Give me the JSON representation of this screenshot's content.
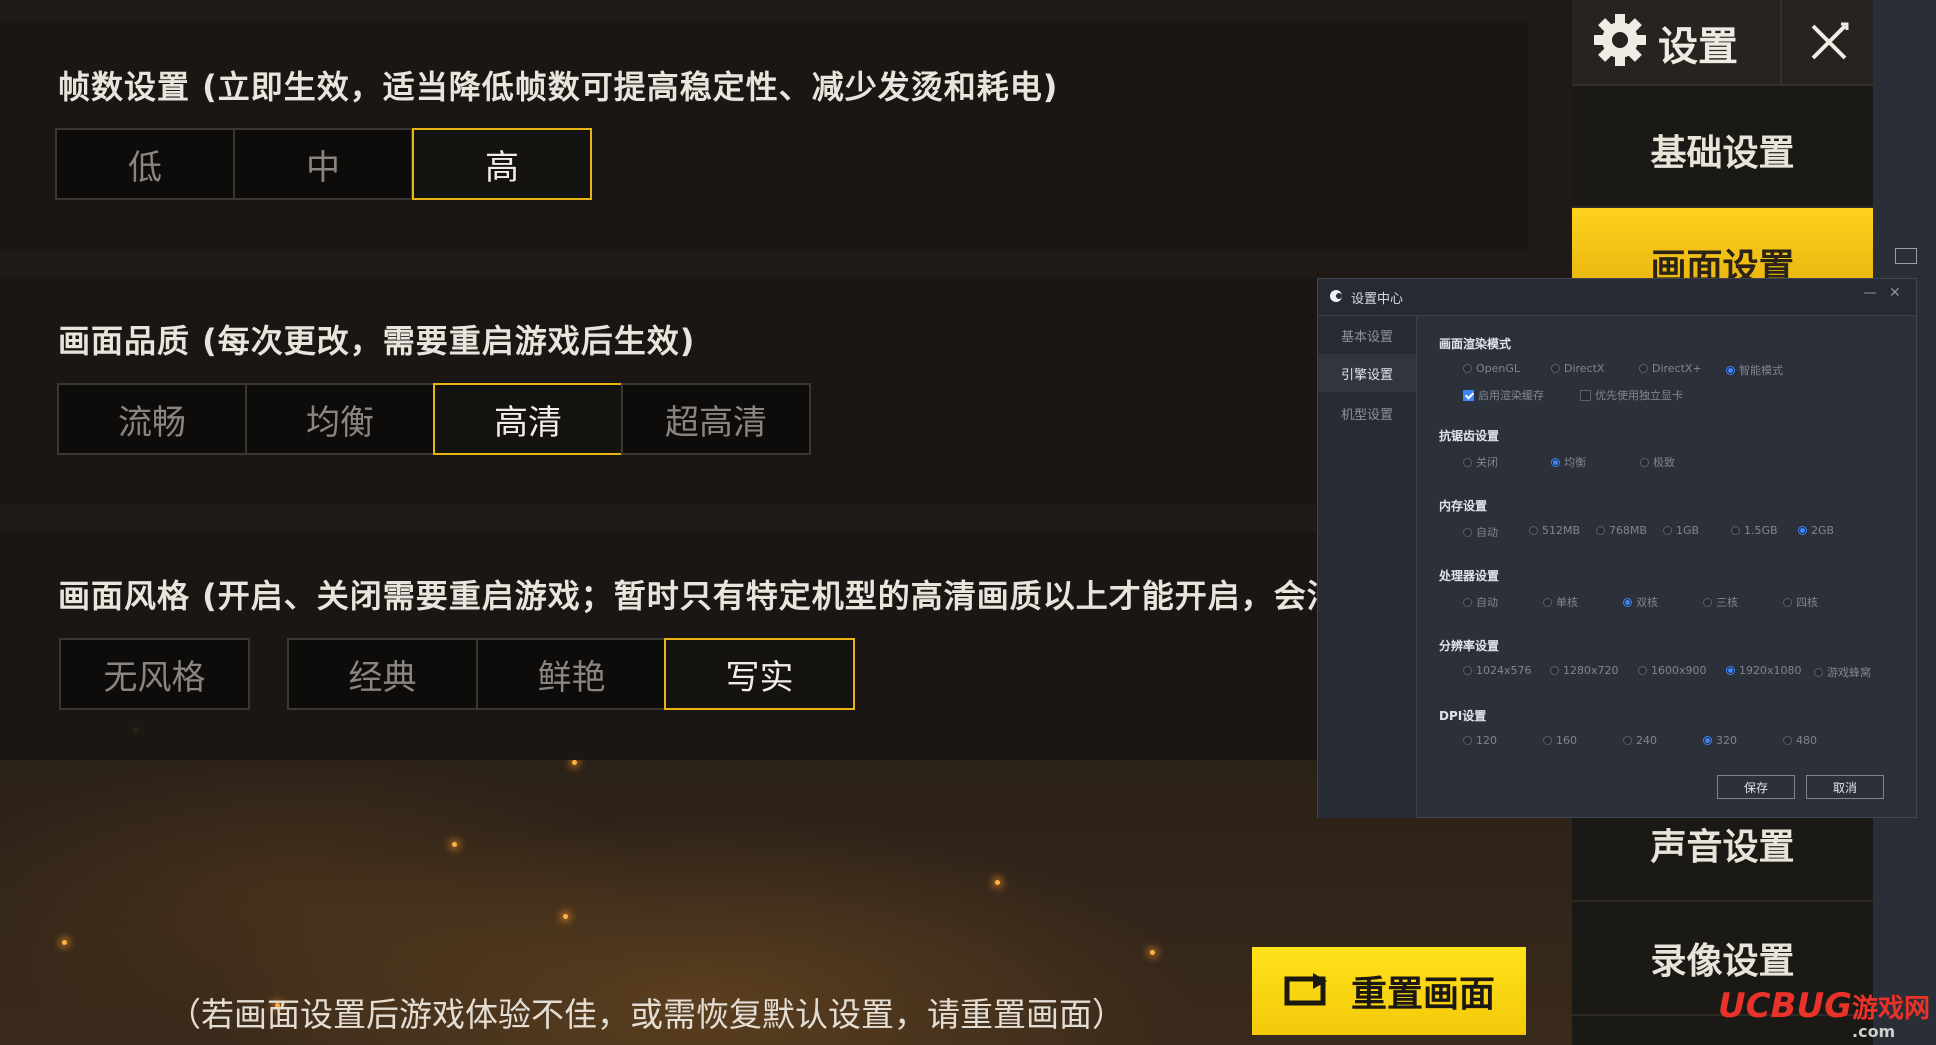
{
  "game": {
    "frame_section": {
      "title": "帧数设置 (立即生效，适当降低帧数可提高稳定性、减少发烫和耗电)",
      "options": [
        "低",
        "中",
        "高"
      ],
      "selected": "高"
    },
    "quality_section": {
      "title": "画面品质 (每次更改，需要重启游戏后生效)",
      "options": [
        "流畅",
        "均衡",
        "高清",
        "超高清"
      ],
      "selected": "高清"
    },
    "style_section": {
      "title": "画面风格 (开启、关闭需要重启游戏；暂时只有特定机型的高清画质以上才能开启，会消",
      "options": [
        "无风格",
        "经典",
        "鲜艳",
        "写实"
      ],
      "selected": "写实"
    },
    "note": "（若画面设置后游戏体验不佳，或需恢复默认设置，请重置画面）",
    "reset_button": "重置画面"
  },
  "sidebar": {
    "title": "设置",
    "items": [
      "基础设置",
      "画面设置",
      "声音设置",
      "录像设置"
    ],
    "active": "画面设置",
    "accent_color": "#f5c814"
  },
  "dialog": {
    "title": "设置中心",
    "nav": [
      "基本设置",
      "引擎设置",
      "机型设置"
    ],
    "active_nav": "引擎设置",
    "render": {
      "label": "画面渲染模式",
      "options": [
        "OpenGL",
        "DirectX",
        "DirectX+",
        "智能模式"
      ],
      "selected": "智能模式",
      "checkboxes": [
        {
          "label": "启用渲染缓存",
          "checked": true
        },
        {
          "label": "优先使用独立显卡",
          "checked": false
        }
      ]
    },
    "antialias": {
      "label": "抗锯齿设置",
      "options": [
        "关闭",
        "均衡",
        "极致"
      ],
      "selected": "均衡"
    },
    "memory": {
      "label": "内存设置",
      "options": [
        "自动",
        "512MB",
        "768MB",
        "1GB",
        "1.5GB",
        "2GB"
      ],
      "selected": "2GB"
    },
    "cpu": {
      "label": "处理器设置",
      "options": [
        "自动",
        "单核",
        "双核",
        "三核",
        "四核"
      ],
      "selected": "双核"
    },
    "resolution": {
      "label": "分辨率设置",
      "options": [
        "1024x576",
        "1280x720",
        "1600x900",
        "1920x1080",
        "游戏蜂窝"
      ],
      "selected": "1920x1080"
    },
    "dpi": {
      "label": "DPI设置",
      "options": [
        "120",
        "160",
        "240",
        "320",
        "480"
      ],
      "selected": "320"
    },
    "save_button": "保存",
    "cancel_button": "取消",
    "radio_color": "#3b86ff"
  },
  "watermark": {
    "text1": "UCBUG",
    "text2": "游戏网",
    "text3": ".com"
  }
}
